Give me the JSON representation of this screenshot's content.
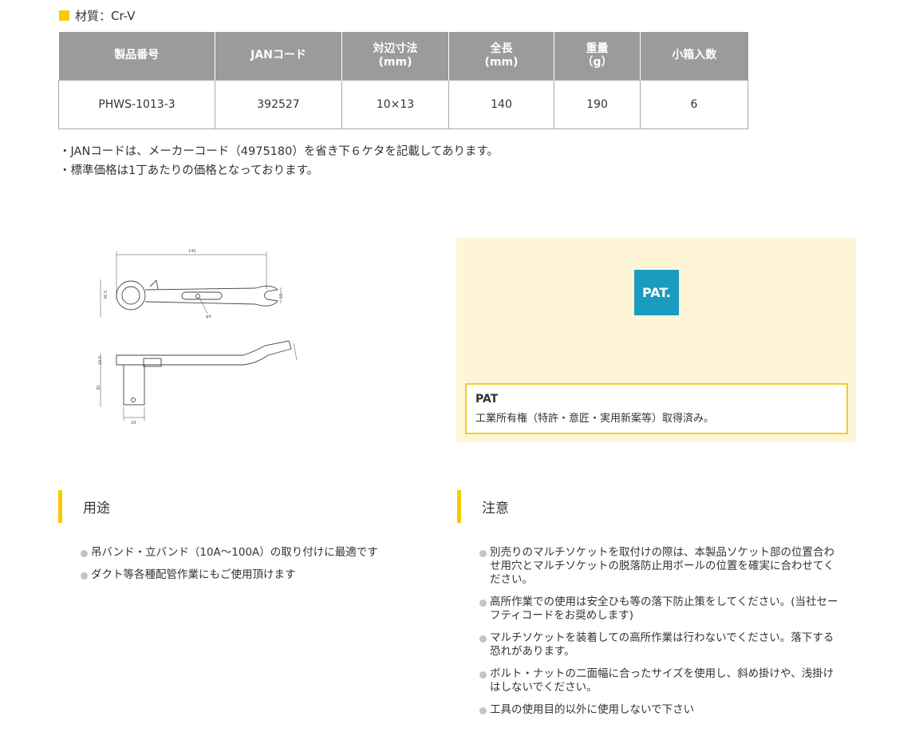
{
  "material": {
    "text": "材質：Cr-V"
  },
  "table": {
    "headers": [
      {
        "line1": "製品番号",
        "line2": ""
      },
      {
        "line1": "JANコード",
        "line2": ""
      },
      {
        "line1": "対辺寸法",
        "line2": "(mm)"
      },
      {
        "line1": "全長",
        "line2": "(mm)"
      },
      {
        "line1": "重量",
        "line2": "（g）"
      },
      {
        "line1": "小箱入数",
        "line2": ""
      }
    ],
    "rows": [
      [
        "PHWS-1013-3",
        "392527",
        "10×13",
        "140",
        "190",
        "6"
      ]
    ]
  },
  "notes": [
    "・JANコードは、メーカーコード（4975180）を省き下６ケタを記載してあります。",
    "・標準価格は1丁あたりの価格となっております。"
  ],
  "drawing": {
    "dim_length": "140",
    "dim_phi": "φ4",
    "dim_height": "30.5",
    "dim_jaw": "12",
    "dim_side_a": "16.5",
    "dim_side_b": "30",
    "dim_base": "18"
  },
  "pat": {
    "logo": "PAT.",
    "title": "PAT",
    "description": "工業所有権（特許・意匠・実用新案等）取得済み。",
    "accent": "#1c9bc0"
  },
  "usage": {
    "heading": "用途",
    "items": [
      "吊バンド・立バンド（10A～100A）の取り付けに最適です",
      "ダクト等各種配管作業にもご使用頂けます"
    ]
  },
  "caution": {
    "heading": "注意",
    "items": [
      "別売りのマルチソケットを取付けの際は、本製品ソケット部の位置合わせ用穴とマルチソケットの脱落防止用ボールの位置を確実に合わせてください。",
      "高所作業での使用は安全ひも等の落下防止策をしてください。(当社セーフティコードをお奨めします)",
      "マルチソケットを装着しての高所作業は行わないでください。落下する恐れがあります。",
      "ボルト・ナットの二面幅に合ったサイズを使用し、斜め掛けや、浅掛けはしないでください。",
      "工具の使用目的以外に使用しないで下さい"
    ]
  },
  "colors": {
    "accent_yellow": "#f8cb00",
    "header_gray": "#9b9b9b"
  }
}
